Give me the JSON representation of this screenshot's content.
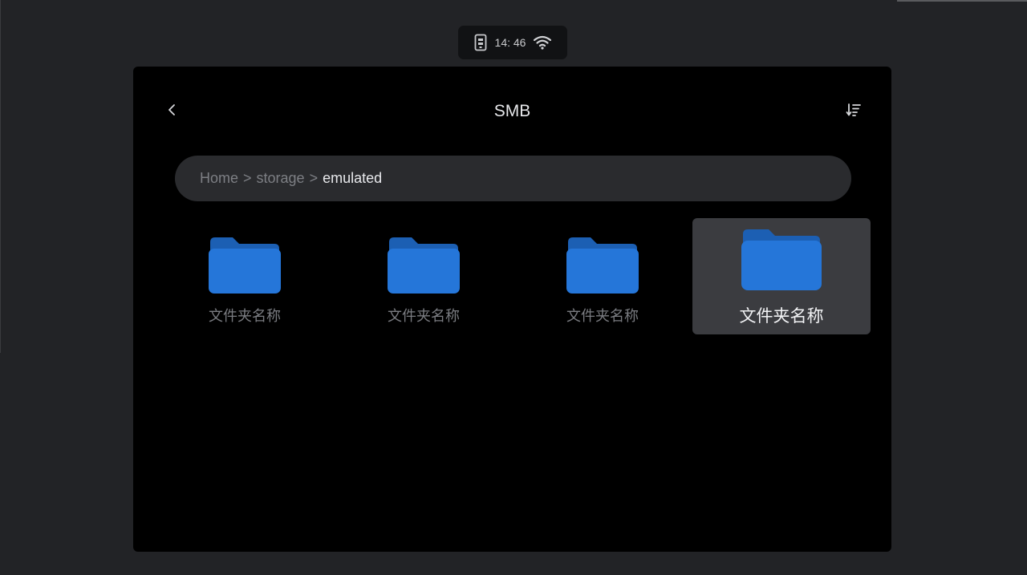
{
  "status_bar": {
    "time": "14: 46",
    "icons": [
      "phone-icon",
      "wifi-icon"
    ]
  },
  "header": {
    "title": "SMB",
    "back_icon": "chevron-left-icon",
    "sort_icon": "sort-icon"
  },
  "breadcrumb": {
    "items": [
      "Home",
      "storage",
      "emulated"
    ],
    "separator": ">"
  },
  "folders": [
    {
      "label": "文件夹名称",
      "selected": false
    },
    {
      "label": "文件夹名称",
      "selected": false
    },
    {
      "label": "文件夹名称",
      "selected": false
    },
    {
      "label": "文件夹名称",
      "selected": true
    }
  ],
  "colors": {
    "folder_blue": "#2576d9",
    "folder_tab_blue": "#1c5fb3",
    "panel_bg": "#000000",
    "selected_bg": "#3b3c40"
  }
}
